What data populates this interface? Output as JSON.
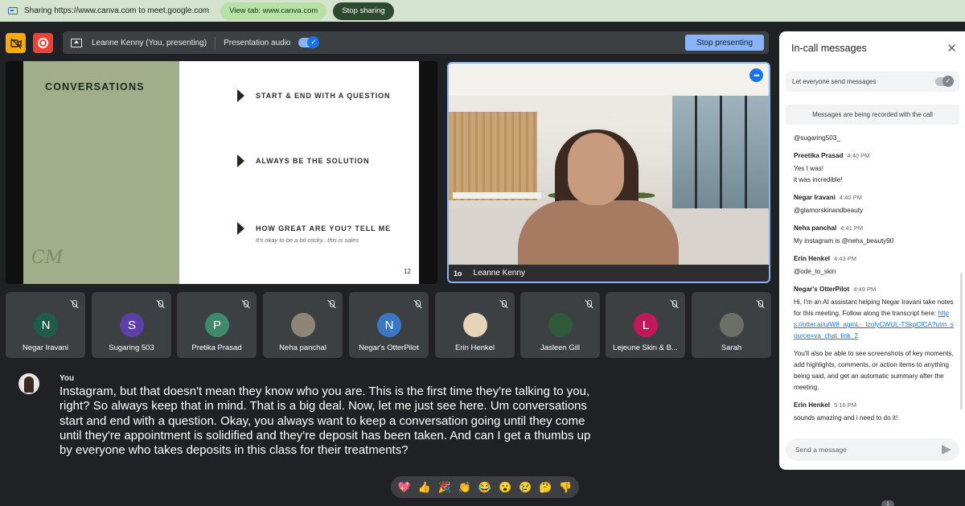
{
  "share_bar": {
    "text": "Sharing https://www.canva.com to meet.google.com",
    "view_tab": "View tab: www.canva.com",
    "stop_sharing": "Stop sharing"
  },
  "present_bar": {
    "presenter": "Leanne Kenny (You, presenting)",
    "audio_label": "Presentation audio",
    "audio_on": true,
    "stop_presenting": "Stop presenting"
  },
  "slide": {
    "title": "CONVERSATIONS",
    "logo": "CM",
    "bullets": [
      {
        "text": "START & END WITH A QUESTION",
        "sub": ""
      },
      {
        "text": "ALWAYS BE THE SOLUTION",
        "sub": ""
      },
      {
        "text": "HOW GREAT ARE YOU? TELL ME",
        "sub": "It's okay to be a bit cocky...this is sales"
      }
    ],
    "page_number": "12"
  },
  "video": {
    "name": "Leanne Kenny",
    "badge": "1o",
    "more": "•••"
  },
  "participants": [
    {
      "name": "Negar Iravani",
      "initial": "N",
      "color": "#1e5c4a"
    },
    {
      "name": "Sugaring 503",
      "initial": "S",
      "color": "#5c3fa8"
    },
    {
      "name": "Pretika Prasad",
      "initial": "P",
      "color": "#3f8a6a"
    },
    {
      "name": "Neha panchal",
      "initial": "",
      "color": "#8e8577"
    },
    {
      "name": "Negar's OtterPilot",
      "initial": "N",
      "color": "#3b78c4"
    },
    {
      "name": "Erin Henkel",
      "initial": "",
      "color": "#e6d3b8"
    },
    {
      "name": "Jasleen Gill",
      "initial": "",
      "color": "#2f5a3a"
    },
    {
      "name": "Lejeune Skin & B...",
      "initial": "L",
      "color": "#c2185b"
    },
    {
      "name": "Sarah",
      "initial": "",
      "color": "#6b6f66"
    }
  ],
  "caption": {
    "speaker": "You",
    "text": "Instagram, but that doesn't mean they know who you are. This is the first time they're talking to you, right? So always keep that in mind. That is a big deal. Now, let me just see here. Um conversations start and end with a question. Okay, you always want to keep a conversation going until they come until they're appointment is solidified and they're deposit has been taken. And can I get a thumbs up by everyone who takes deposits in this class for their treatments?"
  },
  "reactions": [
    "💖",
    "👍",
    "🎉",
    "👏",
    "😂",
    "😮",
    "😢",
    "🤔",
    "👎"
  ],
  "chat": {
    "title": "In-call messages",
    "let_everyone": "Let everyone send messages",
    "recorded_notice": "Messages are being recorded with the call",
    "messages": [
      {
        "sender": "",
        "time": "",
        "lines": [
          "@sugaring503_"
        ]
      },
      {
        "sender": "Preetika Prasad",
        "time": "4:40 PM",
        "lines": [
          "Yes I was!",
          "it was incredible!"
        ]
      },
      {
        "sender": "Negar Iravani",
        "time": "4:40 PM",
        "lines": [
          "@glamorskinandbeauty"
        ]
      },
      {
        "sender": "Neha panchal",
        "time": "4:41 PM",
        "lines": [
          "My instagram is @neha_beauty90"
        ]
      },
      {
        "sender": "Erin Henkel",
        "time": "4:43 PM",
        "lines": [
          "@ode_to_skin"
        ]
      },
      {
        "sender": "Negar's OtterPilot",
        "time": "4:49 PM",
        "lines": [
          "Hi, I'm an AI assistant helping Negar Iravani take notes for this meeting. Follow along the transcript here:",
          "You'll also be able to see screenshots of key moments, add highlights, comments, or action items to anything being said, and get an automatic summary after the meeting."
        ],
        "link": "https://otter.ai/u/W8_agmL-_IzofyCWUL-TSkpCfCA?utm_source=va_chat_link_2"
      },
      {
        "sender": "Erin Henkel",
        "time": "5:16 PM",
        "lines": [
          "sounds amazing and i need to do it!"
        ]
      }
    ],
    "input_placeholder": "Send a message"
  },
  "corner_badge": "1"
}
